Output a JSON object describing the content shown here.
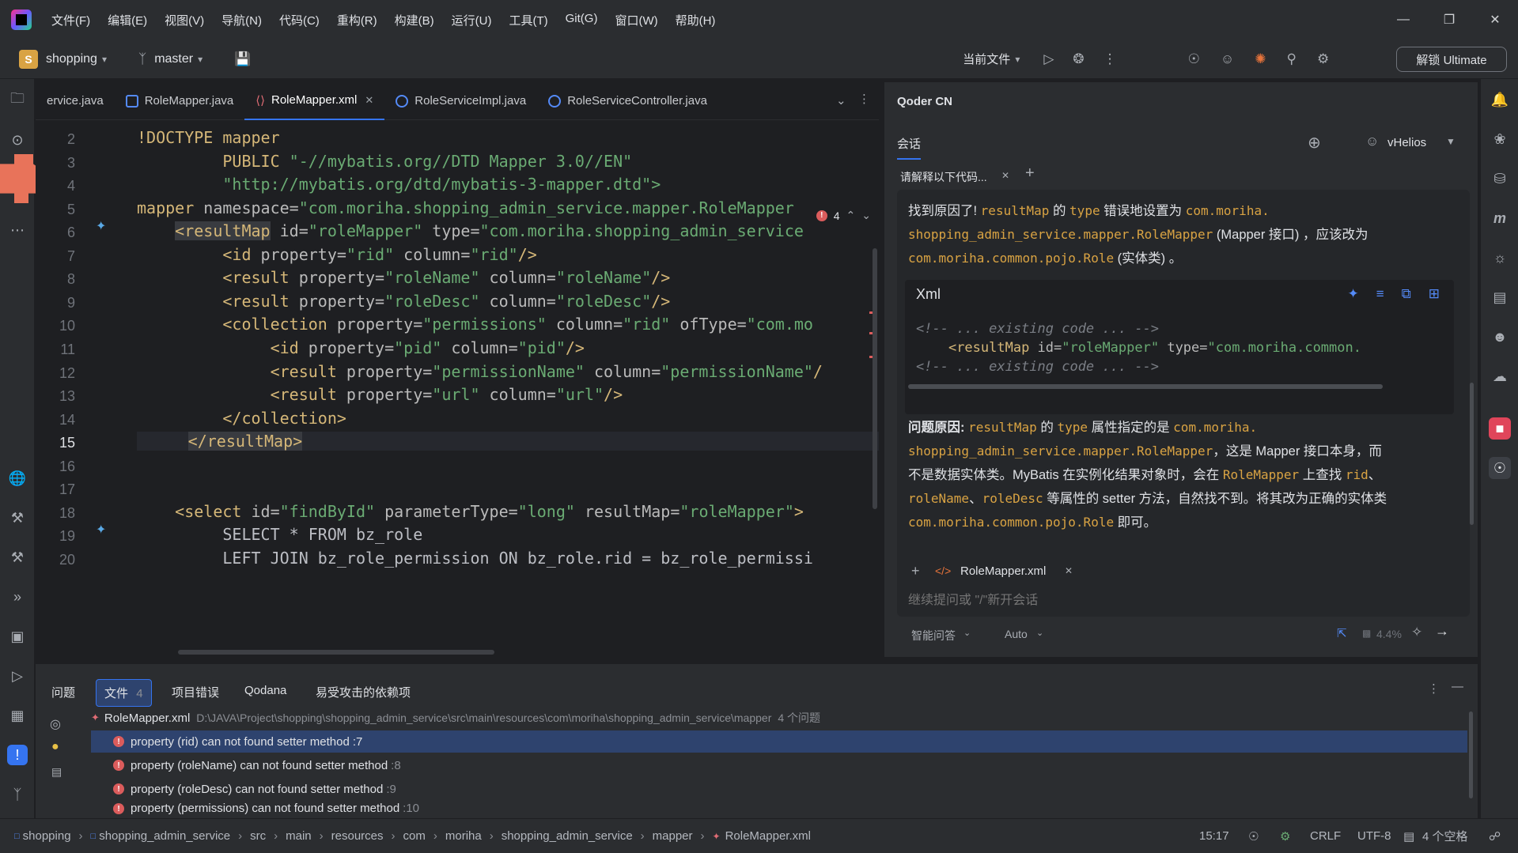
{
  "menu": [
    "文件(F)",
    "编辑(E)",
    "视图(V)",
    "导航(N)",
    "代码(C)",
    "重构(R)",
    "构建(B)",
    "运行(U)",
    "工具(T)",
    "Git(G)",
    "窗口(W)",
    "帮助(H)"
  ],
  "toolbar": {
    "project_initial": "S",
    "project": "shopping",
    "branch": "master",
    "run_config": "当前文件",
    "ultimate_button": "解锁 Ultimate"
  },
  "editor": {
    "tabs": [
      {
        "label": "ervice.java"
      },
      {
        "label": "RoleMapper.java"
      },
      {
        "label": "RoleMapper.xml",
        "active": true
      },
      {
        "label": "RoleServiceImpl.java"
      },
      {
        "label": "RoleServiceController.java"
      }
    ],
    "error_count": "4",
    "line_numbers": [
      "2",
      "3",
      "4",
      "5",
      "6",
      "7",
      "8",
      "9",
      "10",
      "11",
      "12",
      "13",
      "14",
      "15",
      "16",
      "17",
      "18",
      "19",
      "20"
    ],
    "current_line": "15",
    "lines": {
      "l2": "!DOCTYPE mapper",
      "l3a": "PUBLIC ",
      "l3b": "\"-//mybatis.org//DTD Mapper 3.0//EN\"",
      "l4": "\"http://mybatis.org/dtd/mybatis-3-mapper.dtd\">",
      "l5a": "mapper ",
      "l5b": "namespace=",
      "l5c": "\"com.moriha.shopping_admin_service.mapper.RoleMapper",
      "l6a": "<resultMap",
      "l6b": " id=",
      "l6c": "\"roleMapper\"",
      "l6d": " type=",
      "l6e": "\"com.moriha.shopping_admin_service",
      "l7a": "<id ",
      "l7b": "property=",
      "l7c": "\"rid\"",
      "l7d": " column=",
      "l7e": "\"rid\"",
      "l7f": "/>",
      "l8a": "<result ",
      "l8b": "property=",
      "l8c": "\"roleName\"",
      "l8d": " column=",
      "l8e": "\"roleName\"",
      "l8f": "/>",
      "l9a": "<result ",
      "l9b": "property=",
      "l9c": "\"roleDesc\"",
      "l9d": " column=",
      "l9e": "\"roleDesc\"",
      "l9f": "/>",
      "l10a": "<collection ",
      "l10b": "property=",
      "l10c": "\"permissions\"",
      "l10d": " column=",
      "l10e": "\"rid\"",
      "l10f": " ofType=",
      "l10g": "\"com.mo",
      "l11a": "<id ",
      "l11b": "property=",
      "l11c": "\"pid\"",
      "l11d": " column=",
      "l11e": "\"pid\"",
      "l11f": "/>",
      "l12a": "<result ",
      "l12b": "property=",
      "l12c": "\"permissionName\"",
      "l12d": " column=",
      "l12e": "\"permissionName\"",
      "l12f": "/",
      "l13a": "<result ",
      "l13b": "property=",
      "l13c": "\"url\"",
      "l13d": " column=",
      "l13e": "\"url\"",
      "l13f": "/>",
      "l14": "</collection>",
      "l15": "</resultMap>",
      "l18a": "<select ",
      "l18b": "id=",
      "l18c": "\"findById\"",
      "l18d": " parameterType=",
      "l18e": "\"long\"",
      "l18f": " resultMap=",
      "l18g": "\"roleMapper\"",
      "l18h": ">",
      "l19": "SELECT * FROM bz_role",
      "l20": "LEFT JOIN bz_role_permission ON bz_role.rid = bz_role_permissi"
    }
  },
  "qoder": {
    "title": "Qoder CN",
    "tab": "会话",
    "user": "vHelios",
    "session_tab": "请解释以下代码...",
    "answer1": {
      "t1": "找到原因了! ",
      "k1": "resultMap",
      "t2": " 的 ",
      "k2": "type",
      "t3": " 错误地设置为 ",
      "k3": "com.moriha.",
      "k4": "shopping_admin_service.mapper.RoleMapper",
      "t4": " (Mapper 接口) ，应该改为",
      "k5": "com.moriha.common.pojo.Role",
      "t5": " (实体类) 。"
    },
    "codeblock": {
      "lang": "Xml",
      "c1": "<!-- ... existing code ... -->",
      "c2a": "<resultMap",
      "c2b": " id=",
      "c2c": "\"roleMapper\"",
      "c2d": " type=",
      "c2e": "\"com.moriha.common.",
      "c3": "<!-- ... existing code ... -->"
    },
    "answer2": {
      "t1": "问题原因: ",
      "k1": "resultMap",
      "t2": " 的 ",
      "k2": "type",
      "t3": " 属性指定的是 ",
      "k3": "com.moriha.",
      "k4": "shopping_admin_service.mapper.RoleMapper",
      "t4": "，这是 Mapper 接口本身，而",
      "t5": "不是数据实体类。MyBatis 在实例化结果对象时，会在 ",
      "k5": "RoleMapper",
      "t6": " 上查找 ",
      "k6": "rid",
      "t7": "、",
      "k7": "roleName",
      "t8": "、",
      "k8": "roleDesc",
      "t9": " 等属性的 setter 方法，自然找不到。将其改为正确的实体类",
      "k9": "com.moriha.common.pojo.Role",
      "t10": " 即可。"
    },
    "context_file": "RoleMapper.xml",
    "input_placeholder": "继续提问或 \"/\"新开会话",
    "mode": "智能问答",
    "model": "Auto",
    "usage": "4.4%"
  },
  "problems": {
    "tabs": [
      {
        "label": "问题"
      },
      {
        "label": "文件",
        "count": "4",
        "selected": true
      },
      {
        "label": "项目错误"
      },
      {
        "label": "Qodana"
      },
      {
        "label": "易受攻击的依赖项"
      }
    ],
    "file": "RoleMapper.xml",
    "path": "D:\\JAVA\\Project\\shopping\\shopping_admin_service\\src\\main\\resources\\com\\moriha\\shopping_admin_service\\mapper",
    "problem_count": "4 个问题",
    "items": [
      {
        "text": "property (rid) can not found setter method",
        "line": ":7"
      },
      {
        "text": "property (roleName) can not found setter method",
        "line": ":8"
      },
      {
        "text": "property (roleDesc) can not found setter method",
        "line": ":9"
      },
      {
        "text": "property (permissions) can not found setter method",
        "line": ":10"
      }
    ]
  },
  "statusbar": {
    "breadcrumbs": [
      "shopping",
      "shopping_admin_service",
      "src",
      "main",
      "resources",
      "com",
      "moriha",
      "shopping_admin_service",
      "mapper",
      "RoleMapper.xml"
    ],
    "position": "15:17",
    "line_sep": "CRLF",
    "encoding": "UTF-8",
    "indent": "4 个空格"
  },
  "colors": {
    "accent": "#3574f0",
    "error": "#db5c5c",
    "tag": "#d5b778",
    "string": "#6aab73"
  }
}
